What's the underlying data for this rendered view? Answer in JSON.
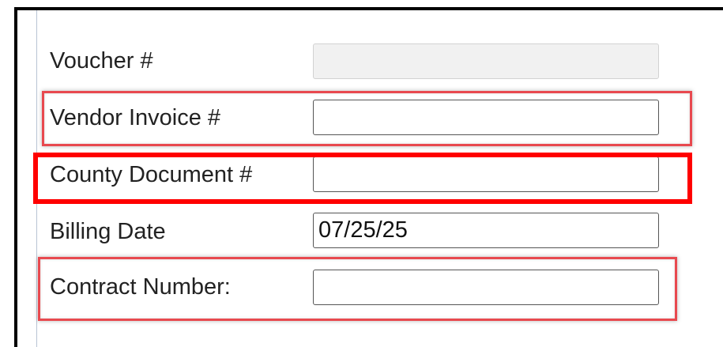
{
  "form": {
    "fields": [
      {
        "label": "Voucher #",
        "value": "",
        "disabled": true
      },
      {
        "label": "Vendor Invoice #",
        "value": ""
      },
      {
        "label": "County Document #",
        "value": ""
      },
      {
        "label": "Billing Date",
        "value": "07/25/25"
      },
      {
        "label": "Contract Number:",
        "value": ""
      }
    ]
  },
  "colors": {
    "highlight_soft": "#e8494f",
    "highlight_strong": "#ff0000",
    "input_border": "#555555",
    "disabled_bg": "#f1f1f1"
  }
}
